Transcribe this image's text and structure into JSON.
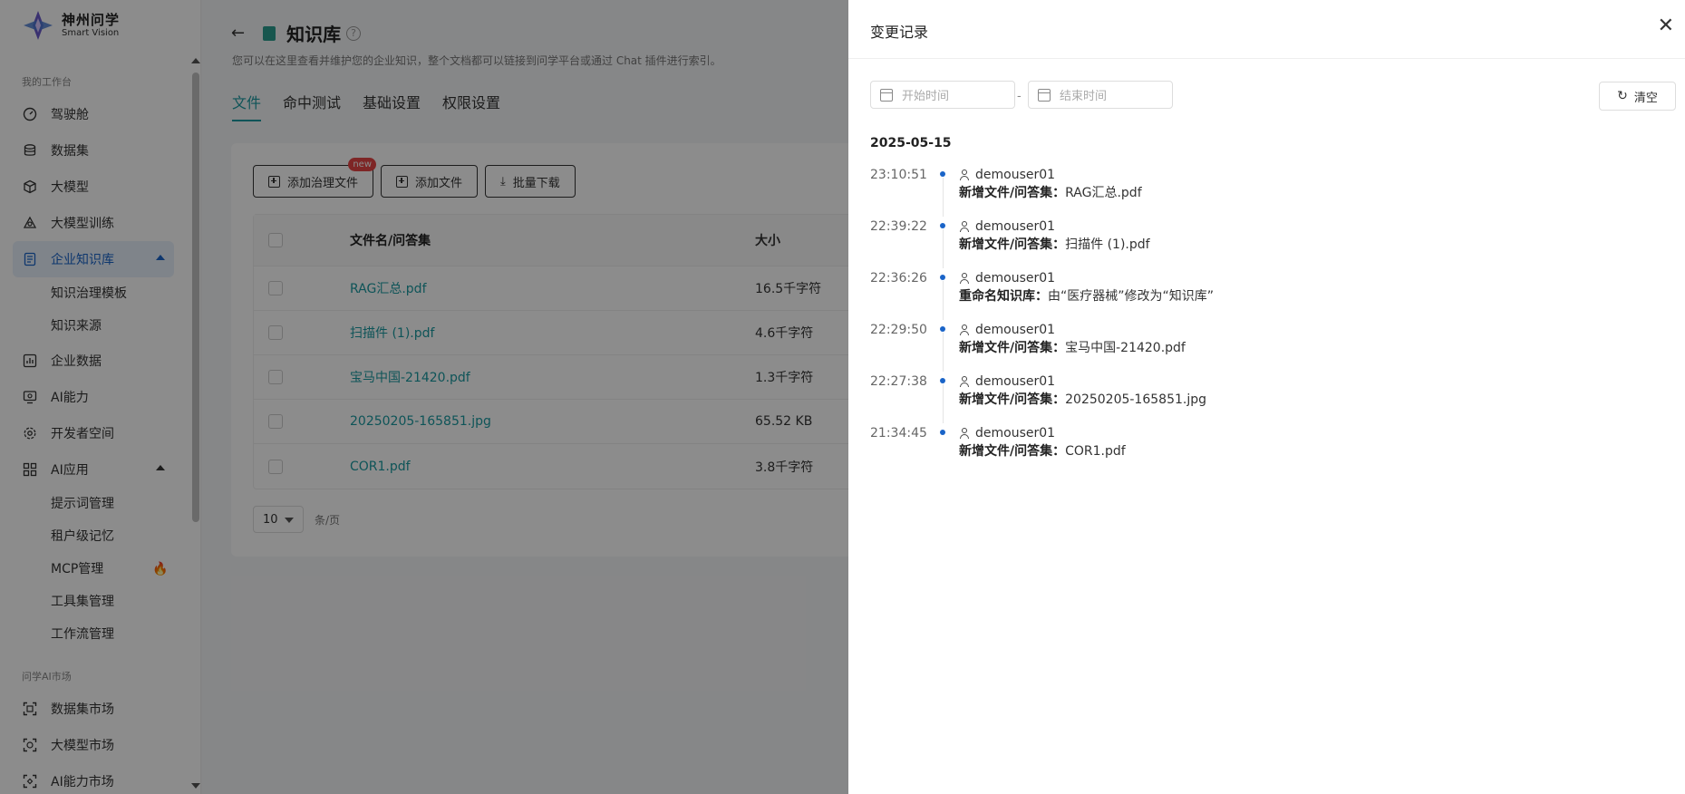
{
  "sidebar": {
    "logo": {
      "title": "神州问学",
      "subtitle": "Smart Vision"
    },
    "sections": {
      "workbench": "我的工作台",
      "market": "问学AI市场"
    },
    "items": {
      "cockpit": "驾驶舱",
      "dataset": "数据集",
      "llm": "大模型",
      "llm_train": "大模型训练",
      "kb": "企业知识库",
      "kb_template": "知识治理模板",
      "kb_source": "知识来源",
      "enterprise_data": "企业数据",
      "ai_capability": "AI能力",
      "dev_space": "开发者空间",
      "ai_app": "AI应用",
      "prompt_mgmt": "提示词管理",
      "tenant_memory": "租户级记忆",
      "mcp_mgmt": "MCP管理",
      "toolset_mgmt": "工具集管理",
      "workflow_mgmt": "工作流管理",
      "dataset_market": "数据集市场",
      "llm_market": "大模型市场",
      "ai_market": "AI能力市场"
    }
  },
  "page": {
    "title": "知识库",
    "description": "您可以在这里查看并维护您的企业知识，整个文档都可以链接到问学平台或通过 Chat 插件进行索引。",
    "tabs": [
      "文件",
      "命中测试",
      "基础设置",
      "权限设置"
    ]
  },
  "toolbar": {
    "add_governance": "添加治理文件",
    "new_badge": "new",
    "add_file": "添加文件",
    "batch_download": "批量下载"
  },
  "table": {
    "headers": {
      "name": "文件名/问答集",
      "size": "大小"
    },
    "rows": [
      {
        "name": "RAG汇总.pdf",
        "size": "16.5千字符"
      },
      {
        "name": "扫描件 (1).pdf",
        "size": "4.6千字符"
      },
      {
        "name": "宝马中国-21420.pdf",
        "size": "1.3千字符"
      },
      {
        "name": "20250205-165851.jpg",
        "size": "65.52 KB"
      },
      {
        "name": "COR1.pdf",
        "size": "3.8千字符"
      }
    ]
  },
  "pager": {
    "page_size": "10",
    "unit": "条/页"
  },
  "drawer": {
    "title": "变更记录",
    "start_placeholder": "开始时间",
    "end_placeholder": "结束时间",
    "date_sep": "-",
    "clear": "清空",
    "day": "2025-05-15",
    "records": [
      {
        "time": "23:10:51",
        "user": "demouser01",
        "action": "新增文件/问答集：",
        "detail": "RAG汇总.pdf"
      },
      {
        "time": "22:39:22",
        "user": "demouser01",
        "action": "新增文件/问答集：",
        "detail": "扫描件 (1).pdf"
      },
      {
        "time": "22:36:26",
        "user": "demouser01",
        "action": "重命名知识库：",
        "detail": "由“医疗器械”修改为“知识库”"
      },
      {
        "time": "22:29:50",
        "user": "demouser01",
        "action": "新增文件/问答集：",
        "detail": "宝马中国-21420.pdf"
      },
      {
        "time": "22:27:38",
        "user": "demouser01",
        "action": "新增文件/问答集：",
        "detail": "20250205-165851.jpg"
      },
      {
        "time": "21:34:45",
        "user": "demouser01",
        "action": "新增文件/问答集：",
        "detail": "COR1.pdf"
      }
    ]
  },
  "colors": {
    "accent": "#1a9aa0",
    "primary": "#1a64c8",
    "badge": "#e64646"
  }
}
